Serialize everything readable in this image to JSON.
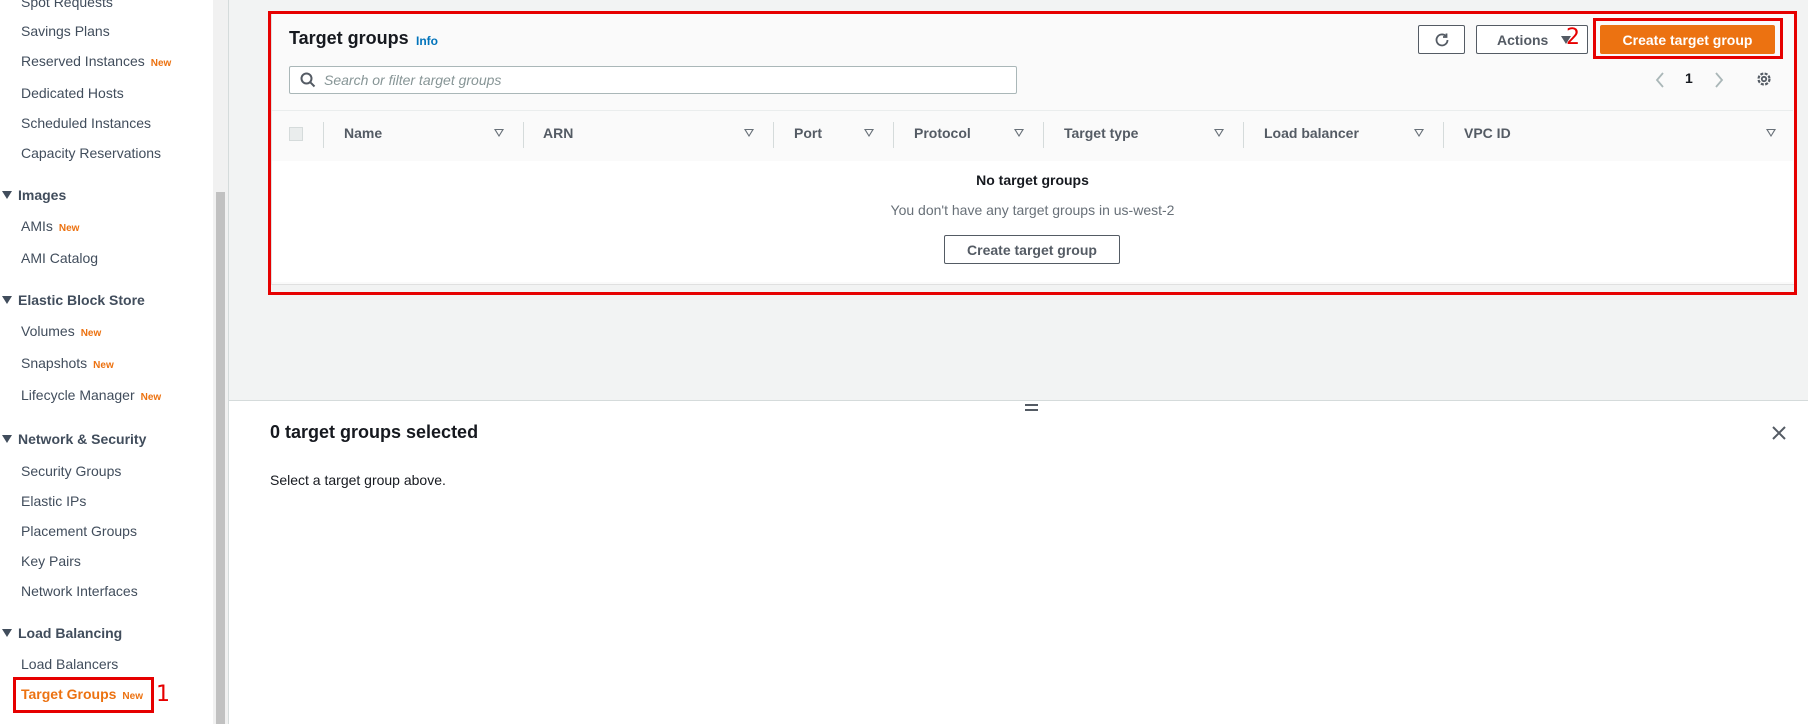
{
  "sidebar": {
    "items_top": [
      {
        "label": "Spot Requests",
        "new": ""
      },
      {
        "label": "Savings Plans",
        "new": ""
      },
      {
        "label": "Reserved Instances",
        "new": "New"
      },
      {
        "label": "Dedicated Hosts",
        "new": ""
      },
      {
        "label": "Scheduled Instances",
        "new": ""
      },
      {
        "label": "Capacity Reservations",
        "new": ""
      }
    ],
    "sections": {
      "images": {
        "title": "Images",
        "items": [
          {
            "label": "AMIs",
            "new": "New"
          },
          {
            "label": "AMI Catalog",
            "new": ""
          }
        ]
      },
      "ebs": {
        "title": "Elastic Block Store",
        "items": [
          {
            "label": "Volumes",
            "new": "New"
          },
          {
            "label": "Snapshots",
            "new": "New"
          },
          {
            "label": "Lifecycle Manager",
            "new": "New"
          }
        ]
      },
      "network": {
        "title": "Network & Security",
        "items": [
          {
            "label": "Security Groups"
          },
          {
            "label": "Elastic IPs"
          },
          {
            "label": "Placement Groups"
          },
          {
            "label": "Key Pairs"
          },
          {
            "label": "Network Interfaces"
          }
        ]
      },
      "lb": {
        "title": "Load Balancing",
        "items": [
          {
            "label": "Load Balancers"
          },
          {
            "label": "Target Groups",
            "new": "New"
          }
        ]
      }
    }
  },
  "annotations": {
    "marker1": "1",
    "marker2": "2"
  },
  "panel": {
    "title": "Target groups",
    "info": "Info",
    "actions_label": "Actions",
    "create_label": "Create target group",
    "search_placeholder": "Search or filter target groups",
    "page_number": "1",
    "columns": [
      "Name",
      "ARN",
      "Port",
      "Protocol",
      "Target type",
      "Load balancer",
      "VPC ID"
    ],
    "empty_title": "No target groups",
    "empty_text": "You don't have any target groups in us-west-2",
    "empty_create_label": "Create target group"
  },
  "split": {
    "title": "0 target groups selected",
    "text": "Select a target group above."
  },
  "colors": {
    "accent": "#ec7211",
    "highlight": "#e60000",
    "link": "#0073bb"
  }
}
